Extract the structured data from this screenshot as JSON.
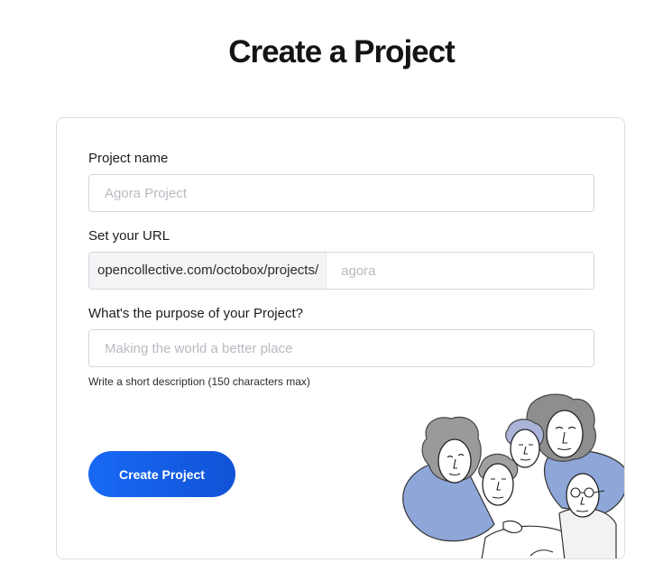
{
  "page": {
    "title": "Create a Project"
  },
  "form": {
    "project_name": {
      "label": "Project name",
      "placeholder": "Agora Project",
      "value": ""
    },
    "url": {
      "label": "Set your URL",
      "prefix": "opencollective.com/octobox/projects/",
      "placeholder": "agora",
      "value": ""
    },
    "purpose": {
      "label": "What's the purpose of your Project?",
      "placeholder": "Making the world a better place",
      "value": "",
      "help": "Write a short description (150 characters max)"
    },
    "submit_label": "Create Project"
  },
  "colors": {
    "button_primary": "#1869f5",
    "card_border": "#dcdee0",
    "input_border": "#d6d8dc",
    "prefix_background": "#f3f4f6"
  },
  "icons": {
    "illustration": "group-of-people-illustration"
  }
}
